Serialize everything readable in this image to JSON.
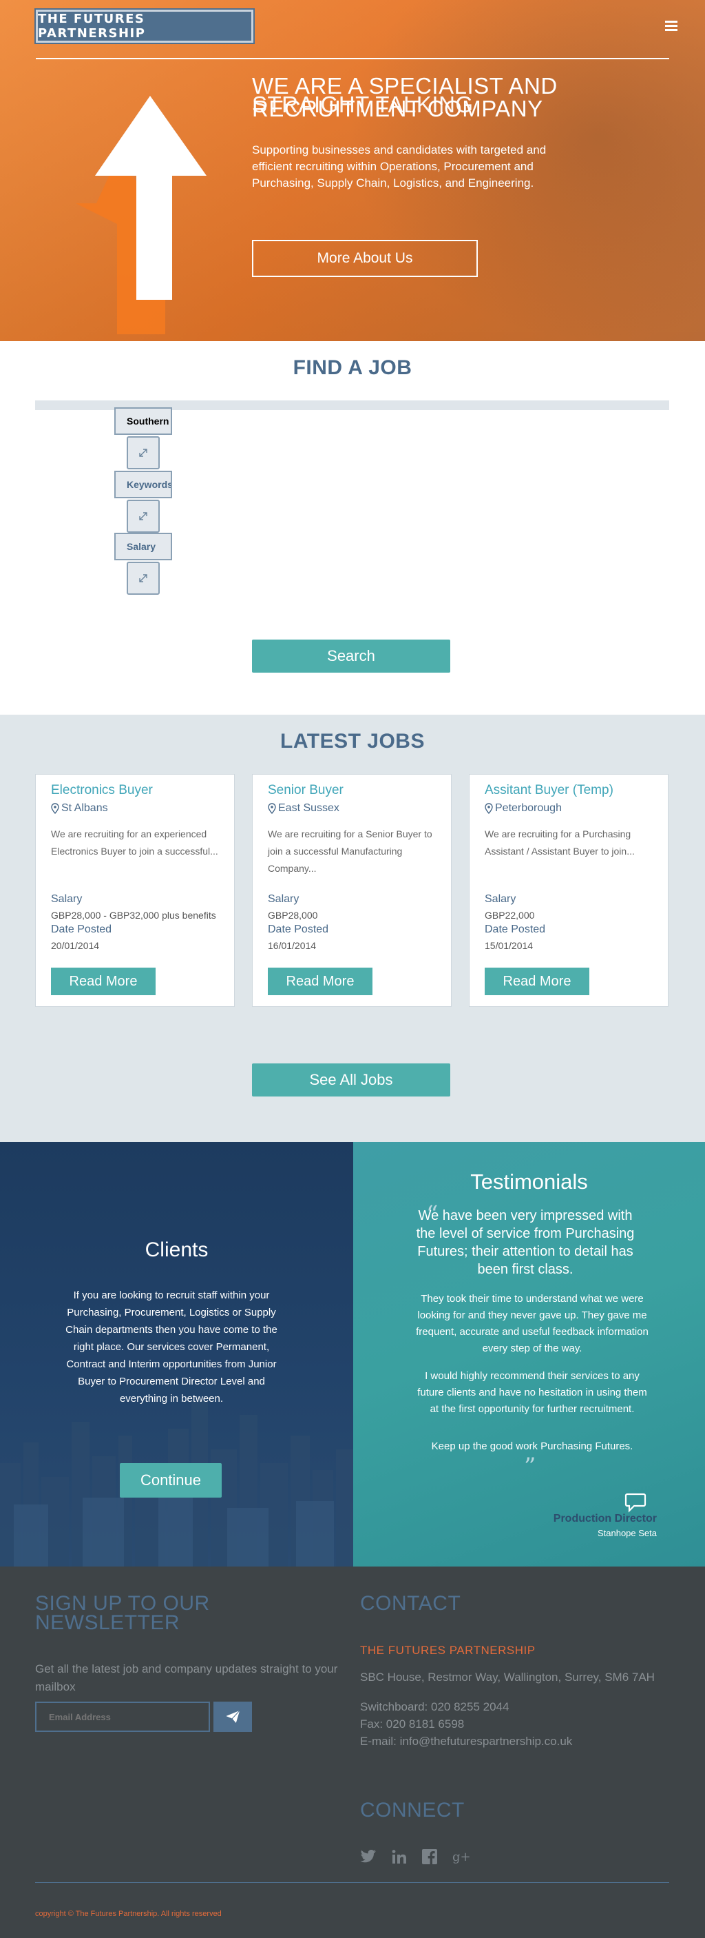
{
  "brand": {
    "logo_text": "THE FUTURES PARTNERSHIP"
  },
  "hero": {
    "title_line1": "WE ARE A SPECIALIST AND",
    "title_line2": "STRAIGHT TALKING",
    "title_line3": "RECRUITMENT COMPANY",
    "text": "Supporting businesses and candidates with targeted and efficient recruiting within Operations, Procurement and Purchasing, Supply Chain, Logistics, and Engineering.",
    "button": "More About Us"
  },
  "find_job": {
    "title": "FIND A JOB",
    "fields": [
      {
        "label": "Southern"
      },
      {
        "label": "Keywords"
      },
      {
        "label": "Salary"
      }
    ],
    "search_button": "Search"
  },
  "latest_jobs": {
    "title": "LATEST JOBS",
    "salary_label": "Salary",
    "date_label": "Date Posted",
    "read_more": "Read More",
    "see_all": "See All Jobs",
    "jobs": [
      {
        "title": "Electronics Buyer",
        "location": "St Albans",
        "desc": "We are recruiting for an experienced Electronics Buyer to join a successful...",
        "salary": "GBP28,000 - GBP32,000 plus benefits",
        "date": "20/01/2014"
      },
      {
        "title": "Senior Buyer",
        "location": "East Sussex",
        "desc": "We are recruiting for a Senior Buyer to join a successful Manufacturing Company...",
        "salary": "GBP28,000",
        "date": "16/01/2014"
      },
      {
        "title": "Assitant Buyer (Temp)",
        "location": "Peterborough",
        "desc": "We are recruiting for a Purchasing Assistant / Assistant Buyer to join...",
        "salary": "GBP22,000",
        "date": "15/01/2014"
      }
    ]
  },
  "clients": {
    "title": "Clients",
    "text": "If you are looking to recruit staff within your Purchasing, Procurement, Logistics or Supply Chain departments then you have come to the right place. Our services cover Permanent, Contract and Interim opportunities from Junior Buyer to Procurement Director Level and everything in between.",
    "button": "Continue"
  },
  "testimonials": {
    "title": "Testimonials",
    "lead": "We have been very impressed with the level of service from Purchasing Futures; their attention to detail has been first class.",
    "p1": "They took their time to understand what we were looking for and they never gave up. They gave me frequent, accurate and useful feedback information every step of the way.",
    "p2": "I would highly recommend their services to any future clients and have no hesitation in using them at the first opportunity for further recruitment.",
    "p3": "Keep up the good work Purchasing Futures.",
    "author": "Production Director",
    "company": "Stanhope Seta"
  },
  "footer": {
    "newsletter_title": "SIGN UP TO OUR NEWSLETTER",
    "newsletter_text": "Get all the latest job and company updates straight to your mailbox",
    "email_placeholder": "Email Address",
    "contact_title": "CONTACT",
    "company": "THE FUTURES PARTNERSHIP",
    "address": "SBC House, Restmor Way, Wallington, Surrey, SM6 7AH",
    "switchboard": "Switchboard: 020 8255 2044",
    "fax": "Fax: 020 8181 6598",
    "email": "E-mail: info@thefuturespartnership.co.uk",
    "connect_title": "CONNECT",
    "copyright": "copyright © The Futures Partnership. All rights reserved"
  },
  "colors": {
    "orange": "#e8772a",
    "teal": "#4eafac",
    "navy": "#4f6f8e",
    "accent_red": "#e36b3b",
    "footer_bg": "#3e4447"
  },
  "icons": [
    "menu-icon",
    "map-pin-icon",
    "expand-icon",
    "quote-open-icon",
    "quote-close-icon",
    "chat-bubble-icon",
    "send-icon",
    "twitter-icon",
    "linkedin-icon",
    "facebook-icon",
    "google-plus-icon"
  ]
}
